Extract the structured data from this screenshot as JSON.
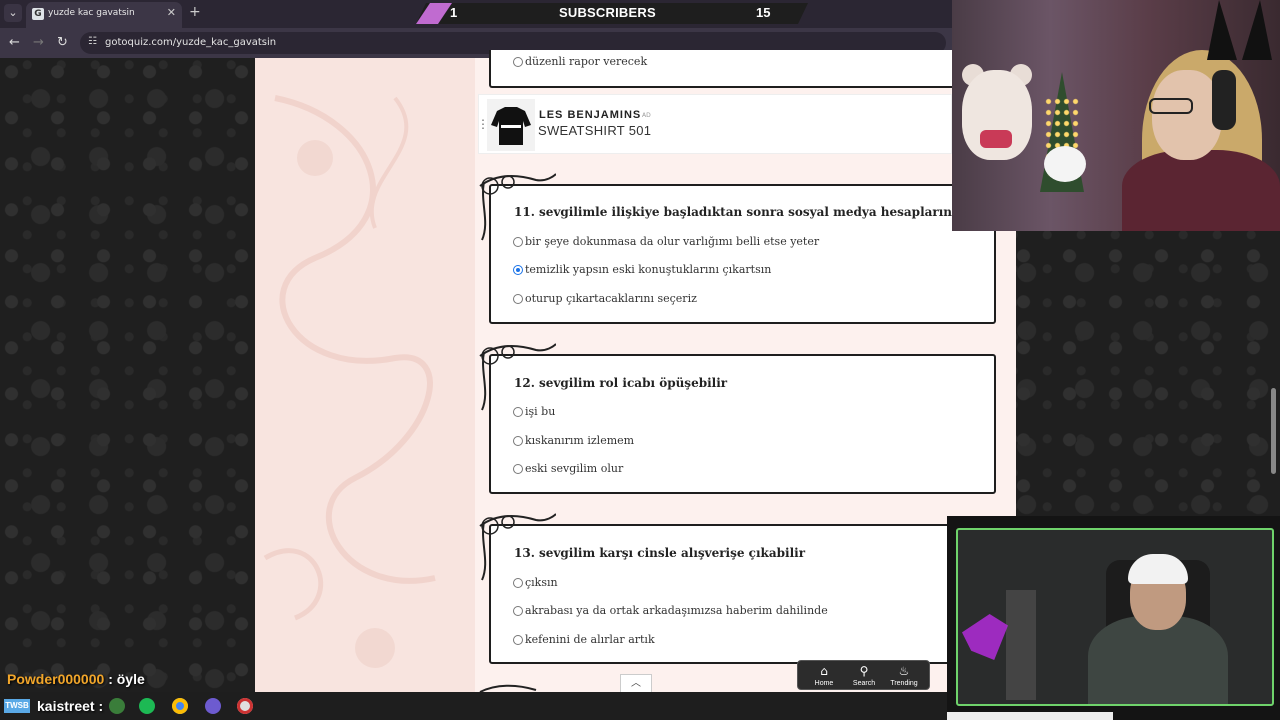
{
  "browser": {
    "tab_title": "yuzde kac gavatsin",
    "favicon_letter": "G",
    "url": "gotoquiz.com/yuzde_kac_gavatsin"
  },
  "subs_banner": {
    "count": "1",
    "label": "SUBSCRIBERS",
    "goal": "15",
    "accent_color": "#c06bd0"
  },
  "quiz": {
    "prev_option": "düzenli rapor verecek",
    "ad": {
      "brand": "LES BENJAMINS",
      "tag": "AD",
      "product": "SWEATSHIRT 501"
    },
    "questions": [
      {
        "title": "11. sevgilimle ilişkiye başladıktan sonra sosyal medya hesaplarında",
        "options": [
          "bir şeye dokunmasa da olur varlığımı belli etse yeter",
          "temizlik yapsın eski konuştuklarını çıkartsın",
          "oturup çıkartacaklarını seçeriz"
        ],
        "selected": 1
      },
      {
        "title": "12. sevgilim rol icabı öpüşebilir",
        "options": [
          "işi bu",
          "kıskanırım izlemem",
          "eski sevgilim olur"
        ],
        "selected": -1
      },
      {
        "title": "13. sevgilim karşı cinsle alışverişe çıkabilir",
        "options": [
          "çıksın",
          "akrabası ya da ortak arkadaşımızsa haberim dahilinde",
          "kefenini de alırlar artık"
        ],
        "selected": -1
      }
    ]
  },
  "site_nav": {
    "home": "Home",
    "search": "Search",
    "trending": "Trending"
  },
  "chat": [
    {
      "user": "Powder000000",
      "sep": ":",
      "message": "öyle"
    },
    {
      "user": "kaistreet",
      "sep": ":",
      "message": ""
    }
  ],
  "widget_badge": "TWSB",
  "colors": {
    "page_bg": "#fbeeea",
    "frame_green": "#6fd36b",
    "chat_user": "#f2a62a"
  }
}
